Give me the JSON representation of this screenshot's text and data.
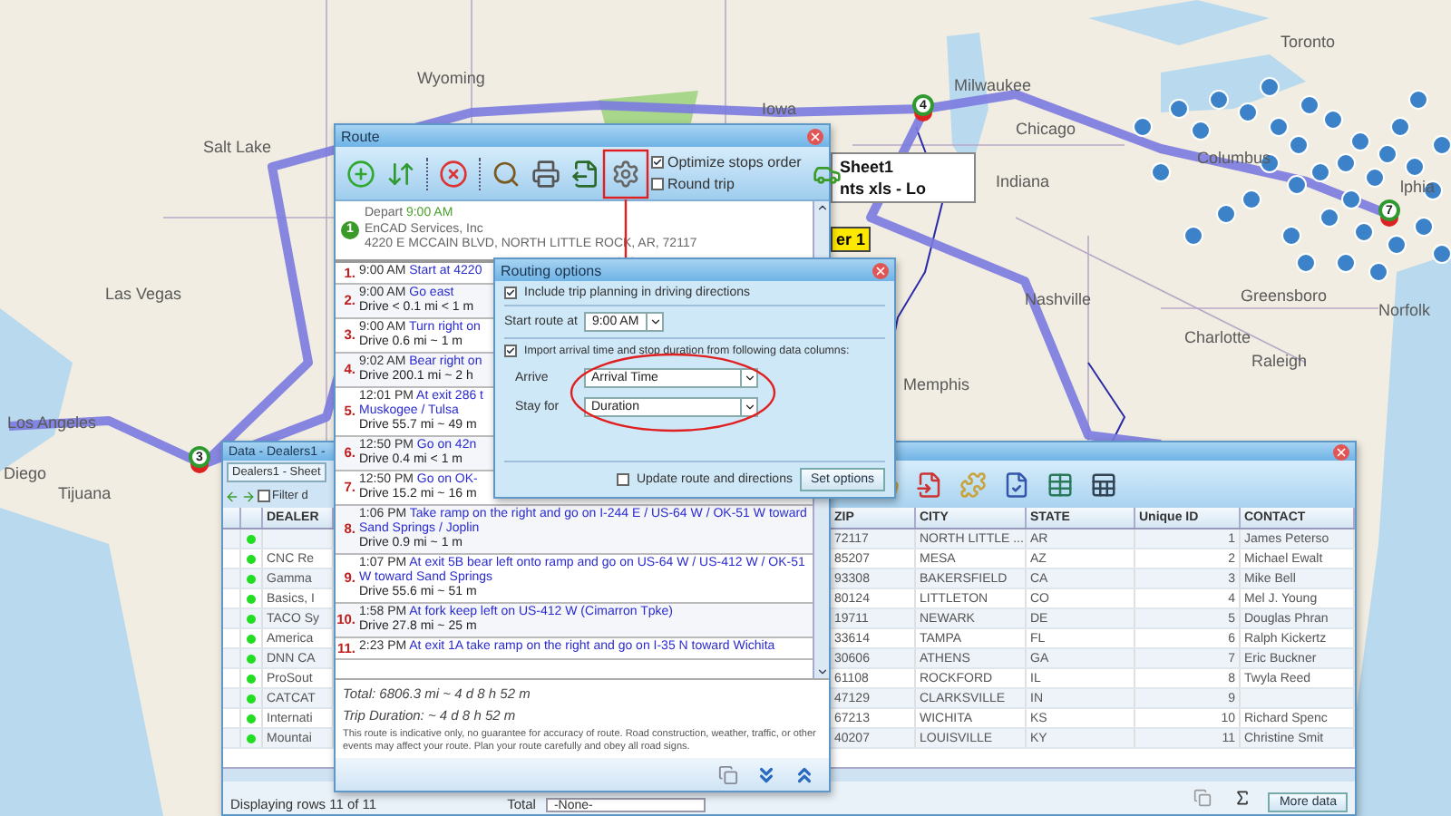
{
  "map": {
    "labels": [
      "Toronto",
      "Milwaukee",
      "Chicago",
      "Wyoming",
      "Salt Lake",
      "Las Vegas",
      "Los Angeles",
      "Diego",
      "Tijuana",
      "Iowa",
      "Indiana",
      "Columbus",
      "Nashville",
      "Memphis",
      "Greensboro",
      "Charlotte",
      "Raleigh",
      "Norfolk",
      "lphia"
    ],
    "stop_markers": [
      "3",
      "4",
      "7"
    ]
  },
  "layer_panel": {
    "lines": [
      "Sheet1",
      "nts xls - Lo"
    ],
    "tag": "er 1"
  },
  "route_window": {
    "title": "Route",
    "options": [
      {
        "label": "Optimize stops order",
        "checked": true
      },
      {
        "label": "Round trip",
        "checked": false
      }
    ],
    "start": {
      "marker": "1",
      "depart_label": "Depart",
      "depart_time": "9:00 AM",
      "name": "EnCAD Services, Inc",
      "address": "4220 E MCCAIN BLVD, NORTH LITTLE ROCK, AR, 72117"
    },
    "steps": [
      {
        "number": "1.",
        "time": "9:00 AM",
        "instruction": "Start at 4220"
      },
      {
        "number": "2.",
        "time": "9:00 AM",
        "instruction": "Go east",
        "drive": "Drive < 0.1 mi < 1 m"
      },
      {
        "number": "3.",
        "time": "9:00 AM",
        "instruction": "Turn right on",
        "drive": "Drive 0.6 mi ~ 1 m"
      },
      {
        "number": "4.",
        "time": "9:02 AM",
        "instruction": "Bear right on",
        "drive": "Drive 200.1 mi ~ 2 h"
      },
      {
        "number": "5.",
        "time": "12:01 PM",
        "instruction": "At exit 286 t",
        "continued": "Muskogee / Tulsa",
        "drive": "Drive 55.7 mi ~ 49 m"
      },
      {
        "number": "6.",
        "time": "12:50 PM",
        "instruction": "Go on 42n",
        "drive": "Drive 0.4 mi < 1 m"
      },
      {
        "number": "7.",
        "time": "12:50 PM",
        "instruction": "Go on OK-",
        "drive": "Drive 15.2 mi ~ 16 m"
      },
      {
        "number": "8.",
        "time": "1:06 PM",
        "instruction": "Take ramp on the right and go on I-244 E / US-64 W / OK-51 W toward Sand Springs / Joplin",
        "drive": "Drive 0.9 mi ~ 1 m"
      },
      {
        "number": "9.",
        "time": "1:07 PM",
        "instruction": "At exit 5B bear left onto ramp and go on US-64 W / US-412 W / OK-51 W toward Sand Springs",
        "drive": "Drive 55.6 mi ~ 51 m"
      },
      {
        "number": "10.",
        "time": "1:58 PM",
        "instruction": "At fork keep left on US-412 W (Cimarron Tpke)",
        "drive": "Drive 27.8 mi ~ 25 m"
      },
      {
        "number": "11.",
        "time": "2:23 PM",
        "instruction": "At exit 1A take ramp on the right and go on I-35 N toward Wichita"
      }
    ],
    "total": "Total: 6806.3 mi ~ 4 d 8 h 52 m",
    "trip_duration": "Trip Duration: ~ 4 d 8 h 52 m",
    "disclaimer": "This route is indicative only, no guarantee for accuracy of route. Road construction, weather, traffic, or other events may affect your route. Plan your route carefully and obey all road signs."
  },
  "routing_options": {
    "title": "Routing options",
    "include_trip_planning": {
      "label": "Include trip planning in driving directions",
      "checked": true
    },
    "start_route": {
      "label": "Start route at",
      "value": "9:00 AM"
    },
    "import_columns": {
      "label": "Import arrival time and stop duration from following data columns:",
      "checked": true
    },
    "fields": [
      {
        "label": "Arrive",
        "value": "Arrival Time"
      },
      {
        "label": "Stay for",
        "value": "Duration"
      }
    ],
    "update_route": {
      "label": "Update route and directions",
      "checked": false
    },
    "button": "Set options"
  },
  "data_window": {
    "title": "Data - Dealers1 -",
    "sheet_tab": "Dealers1 - Sheet",
    "filter": {
      "label": "Filter d",
      "checked": false
    },
    "dealer_column": "DEALER",
    "columns": [
      "ZIP",
      "CITY",
      "STATE",
      "Unique ID",
      "CONTACT"
    ],
    "rows": [
      {
        "zip": "72117",
        "city": "NORTH LITTLE ...",
        "state": "AR",
        "id": "1",
        "contact": "James Peterso"
      },
      {
        "dealer": "CNC Re",
        "zip": "85207",
        "city": "MESA",
        "state": "AZ",
        "id": "2",
        "contact": "Michael Ewalt"
      },
      {
        "dealer": "Gamma",
        "zip": "93308",
        "city": "BAKERSFIELD",
        "state": "CA",
        "id": "3",
        "contact": "Mike Bell"
      },
      {
        "dealer": "Basics, I",
        "zip": "80124",
        "city": "LITTLETON",
        "state": "CO",
        "id": "4",
        "contact": "Mel J. Young"
      },
      {
        "dealer": "TACO Sy",
        "zip": "19711",
        "city": "NEWARK",
        "state": "DE",
        "id": "5",
        "contact": "Douglas Phran"
      },
      {
        "dealer": "America",
        "zip": "33614",
        "city": "TAMPA",
        "state": "FL",
        "id": "6",
        "contact": "Ralph Kickertz"
      },
      {
        "dealer": "DNN CA",
        "zip": "30606",
        "city": "ATHENS",
        "state": "GA",
        "id": "7",
        "contact": "Eric Buckner"
      },
      {
        "dealer": "ProSout",
        "zip": "61108",
        "city": "ROCKFORD",
        "state": "IL",
        "id": "8",
        "contact": "Twyla Reed"
      },
      {
        "dealer": "CATCAT",
        "zip": "47129",
        "city": "CLARKSVILLE",
        "state": "IN",
        "id": "9"
      },
      {
        "dealer": "Internati",
        "zip": "67213",
        "city": "WICHITA",
        "state": "KS",
        "id": "10",
        "contact": "Richard Spenc"
      },
      {
        "dealer": "Mountai",
        "zip": "40207",
        "city": "LOUISVILLE",
        "state": "KY",
        "id": "11",
        "contact": "Christine Smit"
      }
    ],
    "status": "Displaying rows 11 of 11",
    "total_label": "Total",
    "total_select": "-None-",
    "more_button": "More data"
  }
}
